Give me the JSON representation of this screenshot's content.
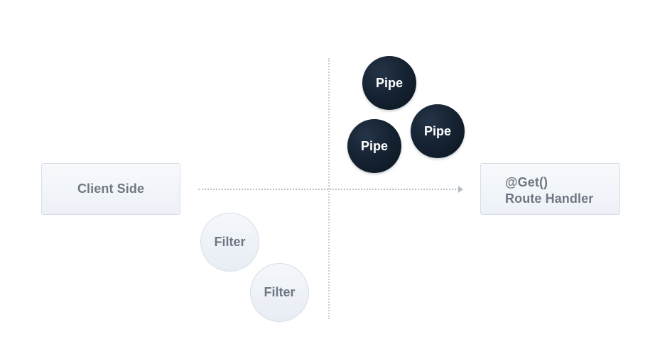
{
  "nodes": {
    "client": {
      "label": "Client Side"
    },
    "route_handler": {
      "line1": "@Get()",
      "line2": "Route Handler"
    }
  },
  "pipes": [
    {
      "label": "Pipe"
    },
    {
      "label": "Pipe"
    },
    {
      "label": "Pipe"
    }
  ],
  "filters": [
    {
      "label": "Filter"
    },
    {
      "label": "Filter"
    }
  ],
  "colors": {
    "pipe_fill": "#162333",
    "pipe_text": "#ffffff",
    "box_fill": "#f2f5f9",
    "box_border": "#d7dee8",
    "muted_text": "#6f7782",
    "line": "#b8bec7"
  }
}
